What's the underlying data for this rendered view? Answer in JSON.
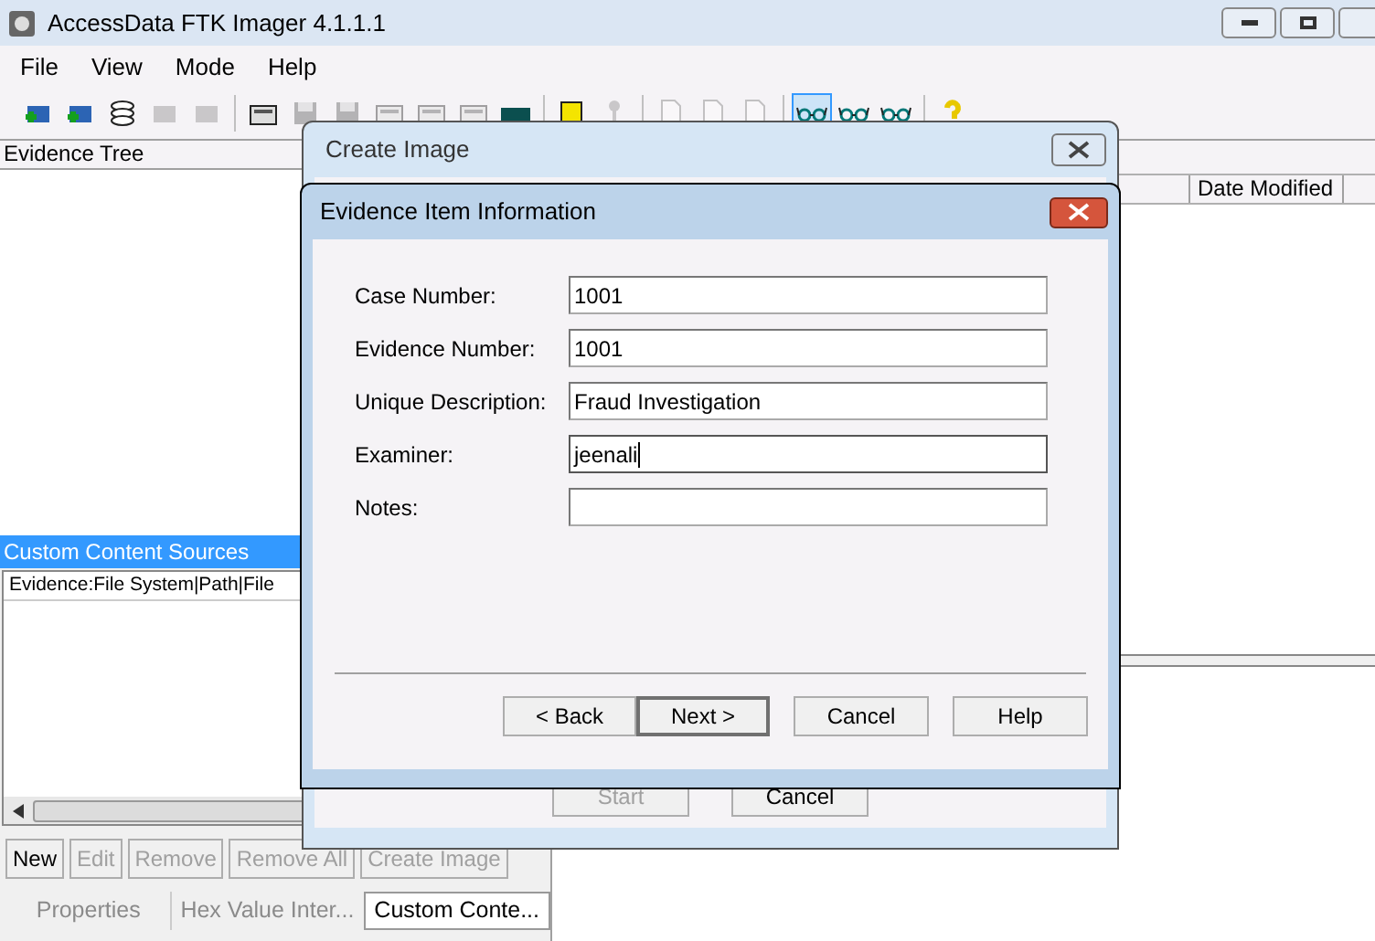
{
  "window": {
    "title": "AccessData FTK Imager 4.1.1.1"
  },
  "menu": [
    "File",
    "View",
    "Mode",
    "Help"
  ],
  "toolbar": [
    {
      "kind": "add",
      "disabled": false,
      "selected": false
    },
    {
      "kind": "add",
      "disabled": false,
      "selected": false
    },
    {
      "kind": "stack",
      "disabled": false,
      "selected": false
    },
    {
      "kind": "remove",
      "disabled": true,
      "selected": false
    },
    {
      "kind": "remove",
      "disabled": true,
      "selected": false
    },
    {
      "kind": "separator"
    },
    {
      "kind": "drive",
      "disabled": false,
      "selected": false
    },
    {
      "kind": "disk",
      "disabled": true,
      "selected": false
    },
    {
      "kind": "disk",
      "disabled": true,
      "selected": false
    },
    {
      "kind": "drive",
      "disabled": true,
      "selected": false
    },
    {
      "kind": "drive",
      "disabled": true,
      "selected": false
    },
    {
      "kind": "drive",
      "disabled": true,
      "selected": false
    },
    {
      "kind": "memory",
      "disabled": false,
      "selected": false
    },
    {
      "kind": "separator"
    },
    {
      "kind": "folder",
      "disabled": false,
      "selected": false
    },
    {
      "kind": "key",
      "disabled": true,
      "selected": false
    },
    {
      "kind": "separator"
    },
    {
      "kind": "doc",
      "disabled": true,
      "selected": false
    },
    {
      "kind": "doc",
      "disabled": true,
      "selected": false
    },
    {
      "kind": "doc",
      "disabled": true,
      "selected": false
    },
    {
      "kind": "separator"
    },
    {
      "kind": "glasses",
      "disabled": false,
      "selected": true
    },
    {
      "kind": "glasses",
      "disabled": false,
      "selected": false
    },
    {
      "kind": "glasses",
      "disabled": false,
      "selected": false
    },
    {
      "kind": "separator"
    },
    {
      "kind": "help",
      "disabled": false,
      "selected": false
    }
  ],
  "evidence_tree": {
    "title": "Evidence Tree"
  },
  "file_list": {
    "columns": [
      "Date Modified"
    ]
  },
  "custom_content": {
    "title": "Custom Content Sources",
    "header": "Evidence:File System|Path|File",
    "buttons": [
      {
        "label": "New",
        "disabled": false
      },
      {
        "label": "Edit",
        "disabled": true
      },
      {
        "label": "Remove",
        "disabled": true
      },
      {
        "label": "Remove All",
        "disabled": true
      },
      {
        "label": "Create Image",
        "disabled": true
      }
    ]
  },
  "tabs": [
    {
      "label": "Properties",
      "selected": false
    },
    {
      "label": "Hex Value Inter...",
      "selected": false
    },
    {
      "label": "Custom Conte...",
      "selected": true
    }
  ],
  "create_image_dialog": {
    "title": "Create Image",
    "buttons": [
      {
        "label": "Start",
        "disabled": true
      },
      {
        "label": "Cancel",
        "disabled": false
      }
    ]
  },
  "evidence_dialog": {
    "title": "Evidence Item Information",
    "fields": [
      {
        "label": "Case Number:",
        "value": "1001",
        "focused": false
      },
      {
        "label": "Evidence Number:",
        "value": "1001",
        "focused": false
      },
      {
        "label": "Unique Description:",
        "value": "Fraud Investigation",
        "focused": false
      },
      {
        "label": "Examiner:",
        "value": "jeenali",
        "focused": true
      },
      {
        "label": "Notes:",
        "focused": false
      }
    ],
    "buttons": [
      {
        "label": "< Back",
        "default": false
      },
      {
        "label": "Next >",
        "default": true
      },
      {
        "label": "Cancel",
        "default": false
      },
      {
        "label": "Help",
        "default": false
      }
    ]
  }
}
